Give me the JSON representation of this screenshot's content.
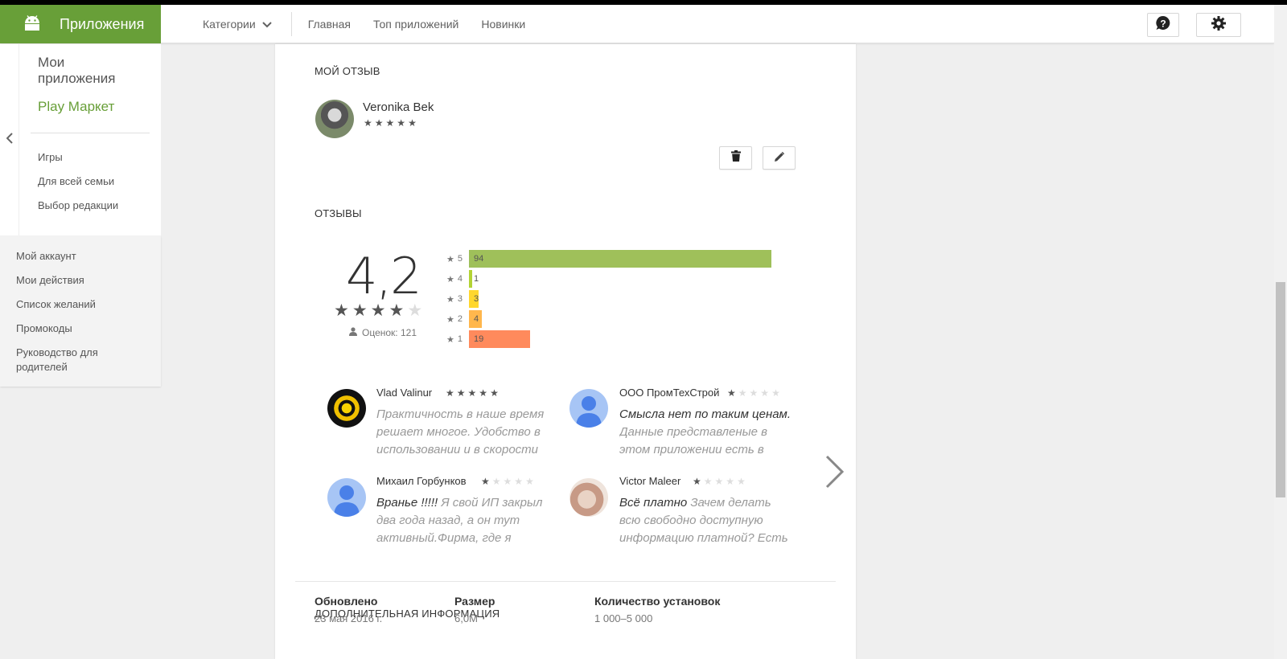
{
  "header": {
    "brand_title": "Приложения",
    "categories_label": "Категории",
    "nav": [
      "Главная",
      "Топ приложений",
      "Новинки"
    ],
    "help_icon": "help-icon",
    "settings_icon": "gear-icon"
  },
  "sidebar": {
    "my_apps": "Мои приложения",
    "play_market": "Play Маркет",
    "items": [
      "Игры",
      "Для всей семьи",
      "Выбор редакции"
    ],
    "account_items": [
      "Мой аккаунт",
      "Мои действия",
      "Список желаний",
      "Промокоды",
      "Руководство для родителей"
    ]
  },
  "my_review": {
    "section_title": "МОЙ ОТЗЫВ",
    "author": "Veronika Bek",
    "stars": 5,
    "delete_icon": "trash-icon",
    "edit_icon": "pencil-icon"
  },
  "reviews": {
    "section_title": "ОТЗЫВЫ",
    "average": "4,2",
    "average_stars": 4,
    "count_label": "Оценок: 121",
    "histogram": [
      {
        "stars": "5",
        "count": "94",
        "color": "#9fc05a"
      },
      {
        "stars": "4",
        "count": "1",
        "color": "#b3d334"
      },
      {
        "stars": "3",
        "count": "3",
        "color": "#ffd72e"
      },
      {
        "stars": "2",
        "count": "4",
        "color": "#ffb74d"
      },
      {
        "stars": "1",
        "count": "19",
        "color": "#ff8a5c"
      }
    ],
    "items": [
      {
        "author": "Vlad Valinur",
        "stars": 5,
        "bold": "",
        "text": "Практичность в наше время решает многое. Удобство в использовании и в скорости"
      },
      {
        "author": "ООО ПромТехСтрой",
        "stars": 1,
        "bold": "Смысла нет по таким ценам.",
        "text": "Данные представленые в этом приложении есть в"
      },
      {
        "author": "Михаил Горбунков",
        "stars": 1,
        "bold": "Вранье !!!!!",
        "text": "Я свой ИП закрыл два года назад, а он тут активный.Фирма, где я"
      },
      {
        "author": "Victor Maleer",
        "stars": 1,
        "bold": "Всё платно",
        "text": "Зачем делать всю свободно доступную информацию платной? Есть"
      }
    ]
  },
  "additional_info": {
    "section_title": "ДОПОЛНИТЕЛЬНАЯ ИНФОРМАЦИЯ",
    "columns": [
      {
        "label": "Обновлено",
        "value": "23 мая 2016 г."
      },
      {
        "label": "Размер",
        "value": "6,0M"
      },
      {
        "label": "Количество установок",
        "value": "1 000–5 000"
      }
    ]
  }
}
